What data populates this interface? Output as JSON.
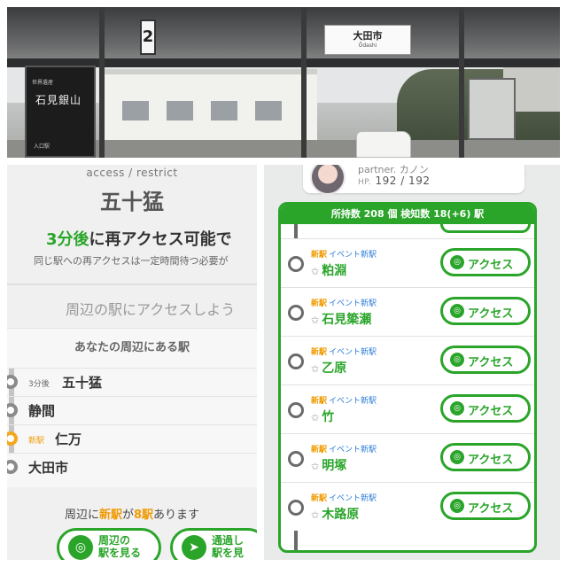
{
  "photo": {
    "station_sign_jp": "大田市",
    "station_sign_romaji": "Ōdashi",
    "platform_number": "2",
    "signboard_title": "石見銀山",
    "signboard_sub": "世界遺産",
    "signboard_small": "入口駅"
  },
  "left": {
    "sub_label": "access / restrict",
    "station_title": "五十猛",
    "reaccess_time": "3分後",
    "reaccess_text": "に再アクセス可能で",
    "reaccess_note": "同じ駅への再アクセスは一定時間待つ必要が",
    "nearby_prompt": "周辺の駅にアクセスしよう",
    "nearby_header": "あなたの周辺にある駅",
    "nearby_stations": [
      {
        "tag": "3分後",
        "name": "五十猛",
        "is_new": false
      },
      {
        "tag": "",
        "name": "静間",
        "is_new": false
      },
      {
        "tag": "新駅",
        "name": "仁万",
        "is_new": true
      },
      {
        "tag": "",
        "name": "大田市",
        "is_new": false
      }
    ],
    "summary_prefix": "周辺に",
    "summary_new": "新駅",
    "summary_mid": "が",
    "summary_count": "8駅",
    "summary_suffix": "あります",
    "button_nearby_line1": "周辺の",
    "button_nearby_line2": "駅を見る",
    "button_pass_line1": "通過し",
    "button_pass_line2": "駅を見",
    "colors": {
      "accent": "#2aa52a",
      "new": "#f09a00"
    }
  },
  "right": {
    "partner_label": "partner.",
    "partner_name": "カノン",
    "hp_label": "HP.",
    "hp_value": "192 / 192",
    "list_header": "所持数 208 個 検知数 18(+6) 駅",
    "tag_new": "新駅",
    "tag_event": "イベント新駅",
    "access_label": "アクセス",
    "stations": [
      "粕淵",
      "石見簗瀬",
      "乙原",
      "竹",
      "明塚",
      "木路原"
    ],
    "colors": {
      "accent": "#2aa52a",
      "event": "#2b7bd6"
    }
  }
}
